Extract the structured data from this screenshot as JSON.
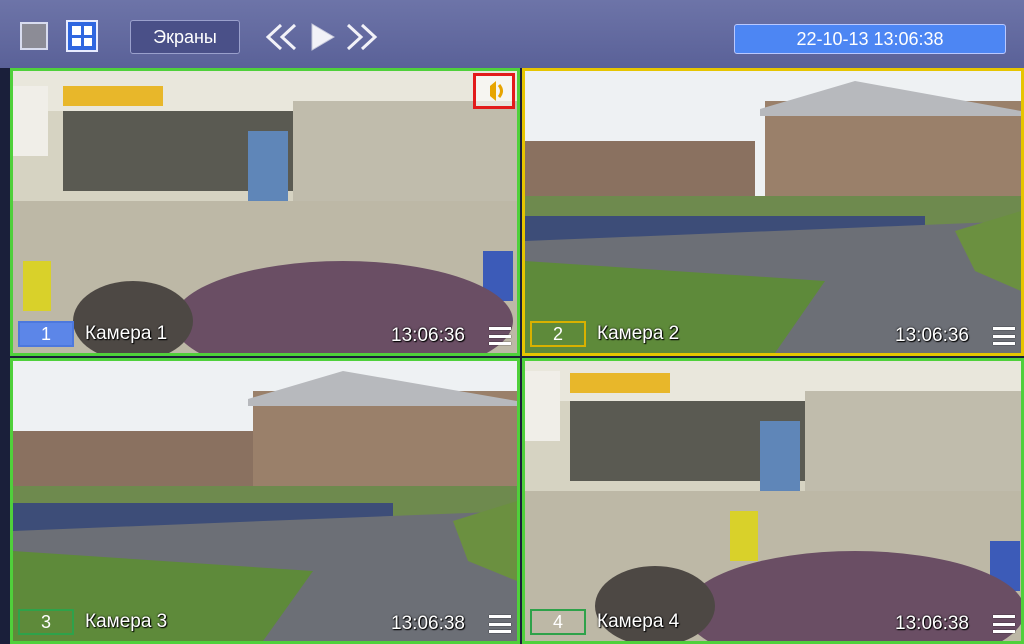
{
  "toolbar": {
    "screens_label": "Экраны",
    "datetime": "22-10-13   13:06:38",
    "icons": {
      "single_view": "single-view-icon",
      "grid_view": "grid-2x2-icon",
      "prev": "double-chevron-left-icon",
      "play": "play-icon",
      "next": "double-chevron-right-icon"
    }
  },
  "cameras": [
    {
      "number": "1",
      "name": "Камера 1",
      "time": "13:06:36",
      "border_color": "#4fd03b",
      "audio_alert": true
    },
    {
      "number": "2",
      "name": "Камера 2",
      "time": "13:06:36",
      "border_color": "#e6c500",
      "audio_alert": false
    },
    {
      "number": "3",
      "name": "Камера 3",
      "time": "13:06:38",
      "border_color": "#4fd03b",
      "audio_alert": false
    },
    {
      "number": "4",
      "name": "Камера 4",
      "time": "13:06:38",
      "border_color": "#4fd03b",
      "audio_alert": false
    }
  ],
  "colors": {
    "toolbar": "#5f66a0",
    "datetime_bg": "#4d86f3",
    "alert_red": "#e21b1b"
  }
}
